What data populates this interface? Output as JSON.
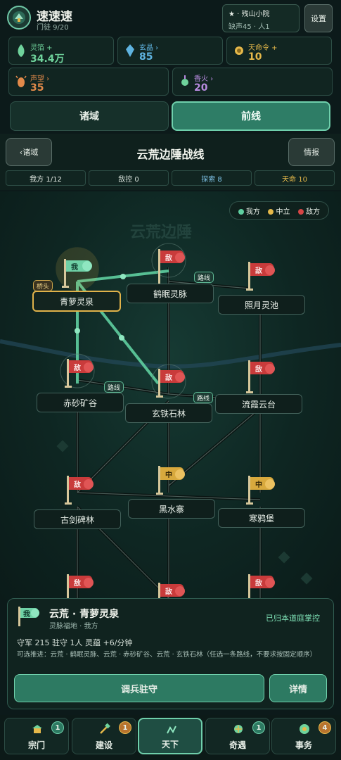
{
  "header": {
    "title": "速速速",
    "subtitle": "门徒 9/20",
    "location_name": "★ · 残山小院",
    "location_stats": "缺声45 · 人1",
    "settings_label": "设置"
  },
  "resources": [
    {
      "label": "灵箔 +",
      "value": "34.4万",
      "icon": "spirit-leaf-icon",
      "color": "#6fd39c"
    },
    {
      "label": "玄晶 ›",
      "value": "85",
      "icon": "crystal-icon",
      "color": "#5fb3e0"
    },
    {
      "label": "天命令 +",
      "value": "10",
      "icon": "sun-token-icon",
      "color": "#e5b84a"
    },
    {
      "label": "声望 ›",
      "value": "35",
      "icon": "reputation-icon",
      "color": "#e28a4a"
    },
    {
      "label": "香火 ›",
      "value": "20",
      "icon": "incense-icon",
      "color": "#b88be0"
    }
  ],
  "tabs": {
    "domains": "诸域",
    "frontline": "前线"
  },
  "battle": {
    "back_label": "‹诸域",
    "title": "云荒边陲战线",
    "intel_label": "情报",
    "stats": [
      {
        "label": "我方 1/12",
        "color": "#e8efe8"
      },
      {
        "label": "敌控 0",
        "color": "#d6e0d9"
      },
      {
        "label": "探索 8",
        "color": "#7fc3e8"
      },
      {
        "label": "天命 10",
        "color": "#e5b84a"
      }
    ]
  },
  "map": {
    "watermark": "云荒边陲",
    "legend": [
      {
        "label": "我方",
        "color": "#5fcfa0"
      },
      {
        "label": "中立",
        "color": "#e5b84a"
      },
      {
        "label": "敌方",
        "color": "#d64545"
      }
    ],
    "bridgehead_tag": "桥头",
    "route_tag": "路线",
    "flags": {
      "ally": "我",
      "enemy": "敌",
      "neutral": "中"
    },
    "nodes": [
      {
        "name": "青萝灵泉",
        "faction": "ally"
      },
      {
        "name": "鹤眠灵脉",
        "faction": "enemy"
      },
      {
        "name": "照月灵池",
        "faction": "enemy"
      },
      {
        "name": "赤砂矿谷",
        "faction": "enemy"
      },
      {
        "name": "玄铁石林",
        "faction": "enemy"
      },
      {
        "name": "流霞云台",
        "faction": "enemy"
      },
      {
        "name": "黑水寨",
        "faction": "neutral"
      },
      {
        "name": "古剑碑林",
        "faction": "enemy"
      },
      {
        "name": "寒鸦堡",
        "faction": "neutral"
      }
    ]
  },
  "info": {
    "flag": "我",
    "name": "云荒 · 青萝灵泉",
    "sub": "灵脉福地 · 我方",
    "status": "已归本道庭掌控",
    "stats": "守军 215   驻守 1人   灵蕴 +6/分钟",
    "advance": "可选推进：云荒 · 鹤眠灵脉、云荒 · 赤砂矿谷、云荒 · 玄铁石林（任选一条路线，不要求按固定顺序）",
    "deploy_label": "调兵驻守",
    "detail_label": "详情"
  },
  "nav": [
    {
      "label": "宗门",
      "badge": "1",
      "badge_color": "#2d7a62"
    },
    {
      "label": "建设",
      "badge": "1",
      "badge_color": "#b8742e"
    },
    {
      "label": "天下",
      "badge": "",
      "badge_color": ""
    },
    {
      "label": "奇遇",
      "badge": "1",
      "badge_color": "#2d7a62"
    },
    {
      "label": "事务",
      "badge": "4",
      "badge_color": "#b8742e"
    }
  ]
}
